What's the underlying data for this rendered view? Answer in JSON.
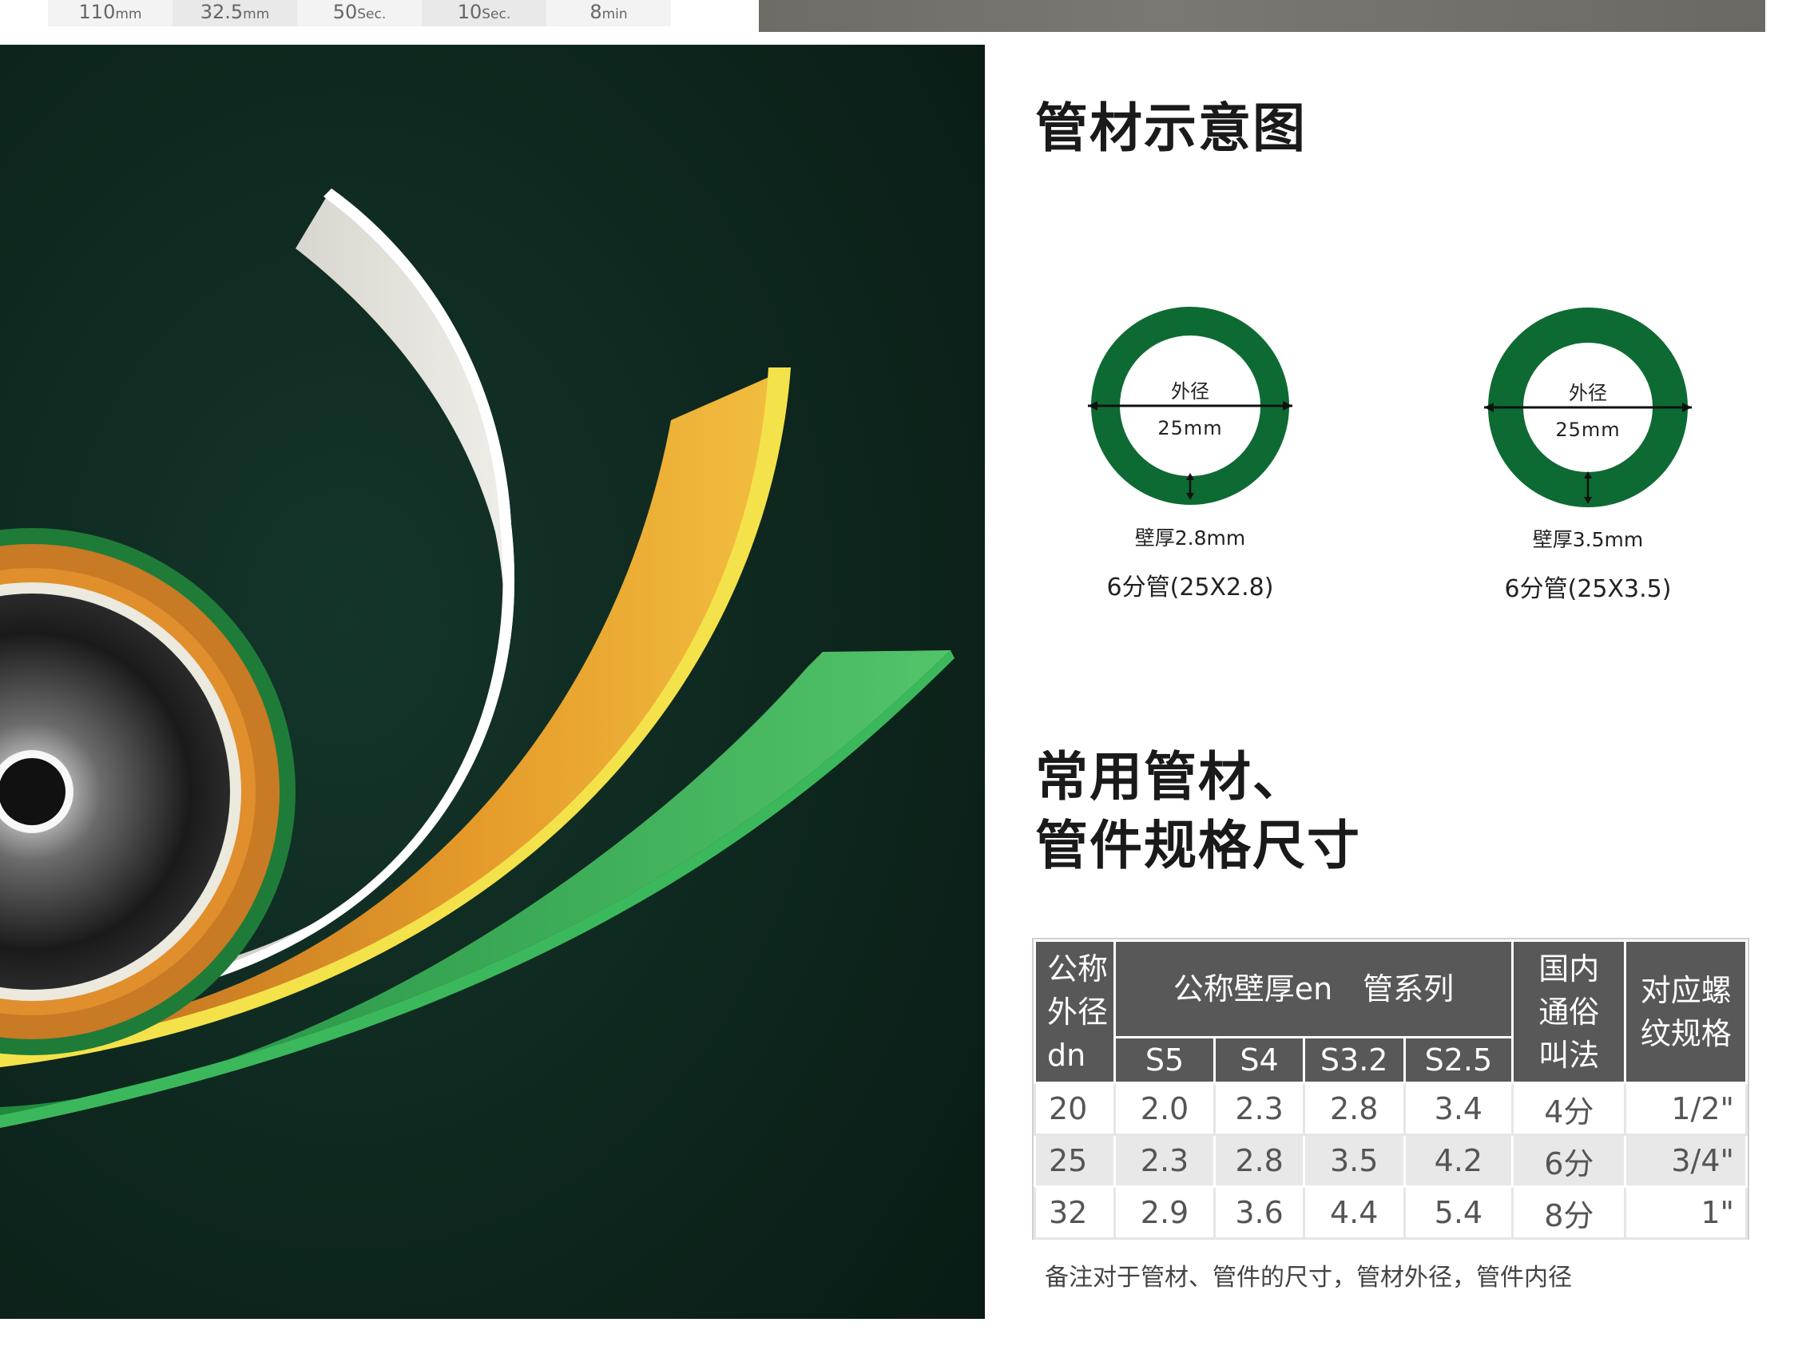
{
  "top_strip": [
    {
      "value": "110",
      "unit": "mm"
    },
    {
      "value": "32.5",
      "unit": "mm"
    },
    {
      "value": "50",
      "unit": "Sec."
    },
    {
      "value": "10",
      "unit": "Sec."
    },
    {
      "value": "8",
      "unit": "min"
    }
  ],
  "headings": {
    "diagram": "管材示意图",
    "specs_line1": "常用管材、",
    "specs_line2": "管件规格尺寸"
  },
  "diagrams": [
    {
      "outer_label": "外径",
      "outer_value": "25mm",
      "wall_label": "壁厚2.8mm",
      "caption": "6分管(25X2.8)",
      "ring_color": "#0e6a33"
    },
    {
      "outer_label": "外径",
      "outer_value": "25mm",
      "wall_label": "壁厚3.5mm",
      "caption": "6分管(25X3.5)",
      "ring_color": "#0e6a33"
    }
  ],
  "table": {
    "header": {
      "nominal_od_lines": [
        "公称",
        "外径",
        "dn"
      ],
      "wall_group": "公称壁厚en　管系列",
      "series": [
        "S5",
        "S4",
        "S3.2",
        "S2.5"
      ],
      "domestic_lines": [
        "国内",
        "通俗",
        "叫法"
      ],
      "thread_lines": [
        "对应螺",
        "纹规格"
      ]
    },
    "rows": [
      [
        "20",
        "2.0",
        "2.3",
        "2.8",
        "3.4",
        "4分",
        "1/2\""
      ],
      [
        "25",
        "2.3",
        "2.8",
        "3.5",
        "4.2",
        "6分",
        "3/4\""
      ],
      [
        "32",
        "2.9",
        "3.6",
        "4.4",
        "5.4",
        "8分",
        "1\""
      ]
    ]
  },
  "note": "备注对于管材、管件的尺寸，管材外径，管件内径",
  "colors": {
    "artwork_background": "#0b2219",
    "ring_green": "#0e6a33",
    "table_header": "#585858"
  }
}
